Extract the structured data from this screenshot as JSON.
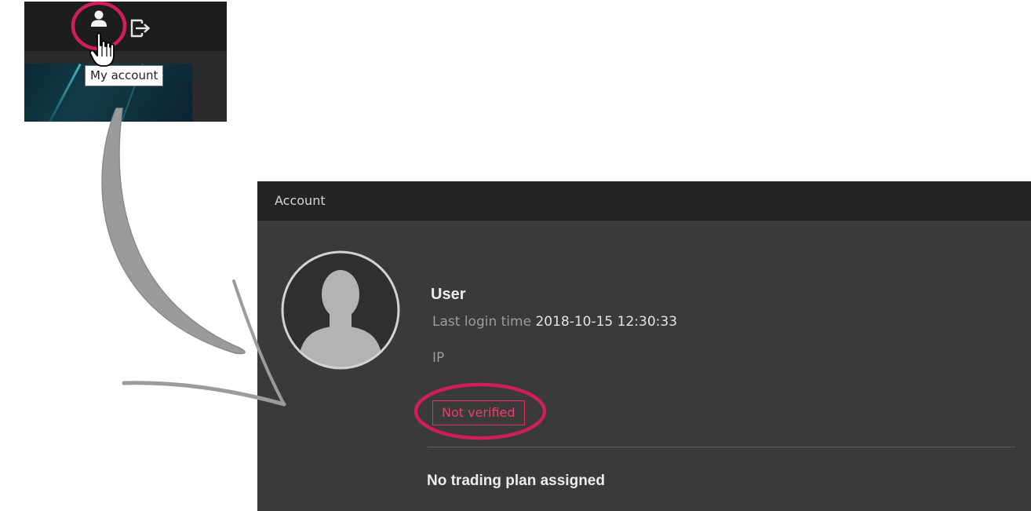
{
  "toolbar": {
    "user_icon": "user-icon",
    "logout_icon": "logout-icon",
    "tooltip": "My account"
  },
  "account": {
    "header_title": "Account",
    "avatar_icon": "person-silhouette-icon",
    "user_name": "User",
    "last_login_label": "Last login time",
    "last_login_value": "2018-10-15 12:30:33",
    "ip_label": "IP",
    "verification_status": "Not verified",
    "trading_plan": "No trading plan assigned"
  },
  "colors": {
    "highlight": "#d01e5a",
    "status_unverified": "#e8406a",
    "panel_bg": "#3a3a3a",
    "header_bg": "#232323"
  }
}
